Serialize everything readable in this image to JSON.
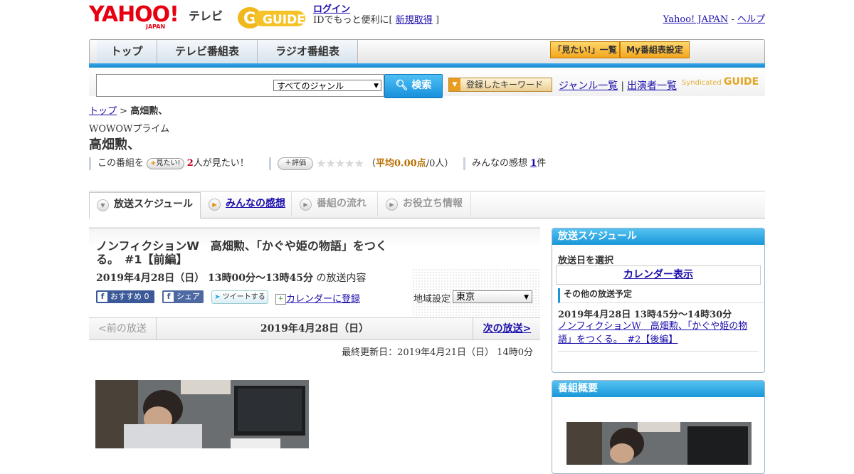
{
  "header": {
    "logo_text": "YAHOO!",
    "logo_sub": "JAPAN",
    "service_name": "テレビ",
    "gguide_text": "GUIDE",
    "login_label": "ログイン",
    "login_note": "IDでもっと便利に[",
    "signup_label": "新規取得",
    "login_close": "]",
    "yahoo_japan": "Yahoo! JAPAN",
    "separator": "-",
    "help": "ヘルプ"
  },
  "nav": {
    "tabs": [
      "トップ",
      "テレビ番組表",
      "ラジオ番組表"
    ],
    "want_list": "「見たい!」一覧",
    "my_settings": "My番組表設定"
  },
  "search": {
    "placeholder": "",
    "genre": "すべてのジャンル",
    "button": "検索",
    "keyword_button": "登録したキーワード",
    "genre_list": "ジャンル一覧",
    "cast_list": "出演者一覧",
    "syndicated": "Syndicated",
    "syndicated_g": "GUIDE"
  },
  "breadcrumb": {
    "top": "トップ",
    "sep": ">",
    "current": "高畑勲、"
  },
  "program": {
    "channel": "WOWOWプライム",
    "title": "高畑勲、",
    "want_prefix": "この番組を",
    "want_button": "見たい!",
    "want_count": "2",
    "want_suffix": "人が見たい！",
    "eval_button": "評価",
    "stars": "★★★★★",
    "avg_open": "（",
    "avg_label": "平均0.00点",
    "avg_rest": "/0人）",
    "impressions_label": "みんなの感想",
    "impressions_count": "1",
    "impressions_suffix": "件"
  },
  "section_tabs": [
    "放送スケジュール",
    "みんなの感想",
    "番組の流れ",
    "お役立ち情報"
  ],
  "episode": {
    "title": "ノンフィクションW　高畑勲、「かぐや姫の物語」をつくる。　#1【前編】",
    "airtime": "2019年4月28日（日）  13時00分～13時45分",
    "airtime_suffix": "の放送内容",
    "fb_recommend": "おすすめ 0",
    "fb_share": "シェア",
    "tweet": "ツイートする",
    "calendar_register": "カレンダーに登録",
    "region_label": "地域設定",
    "region_value": "東京"
  },
  "pager": {
    "prev": "<前の放送",
    "current": "2019年4月28日（日）",
    "next": "次の放送>"
  },
  "updated": "最終更新日：2019年4月21日（日）  14時0分",
  "sidebar": {
    "schedule_title": "放送スケジュール",
    "select_date": "放送日を選択",
    "calendar_button": "カレンダー表示",
    "other_title": "その他の放送予定",
    "other_date": "2019年4月28日  13時45分～14時30分",
    "other_link": "ノンフィクションW　高畑勲、「かぐや姫の物語」をつくる。　#2【後編】",
    "summary_title": "番組概要"
  }
}
